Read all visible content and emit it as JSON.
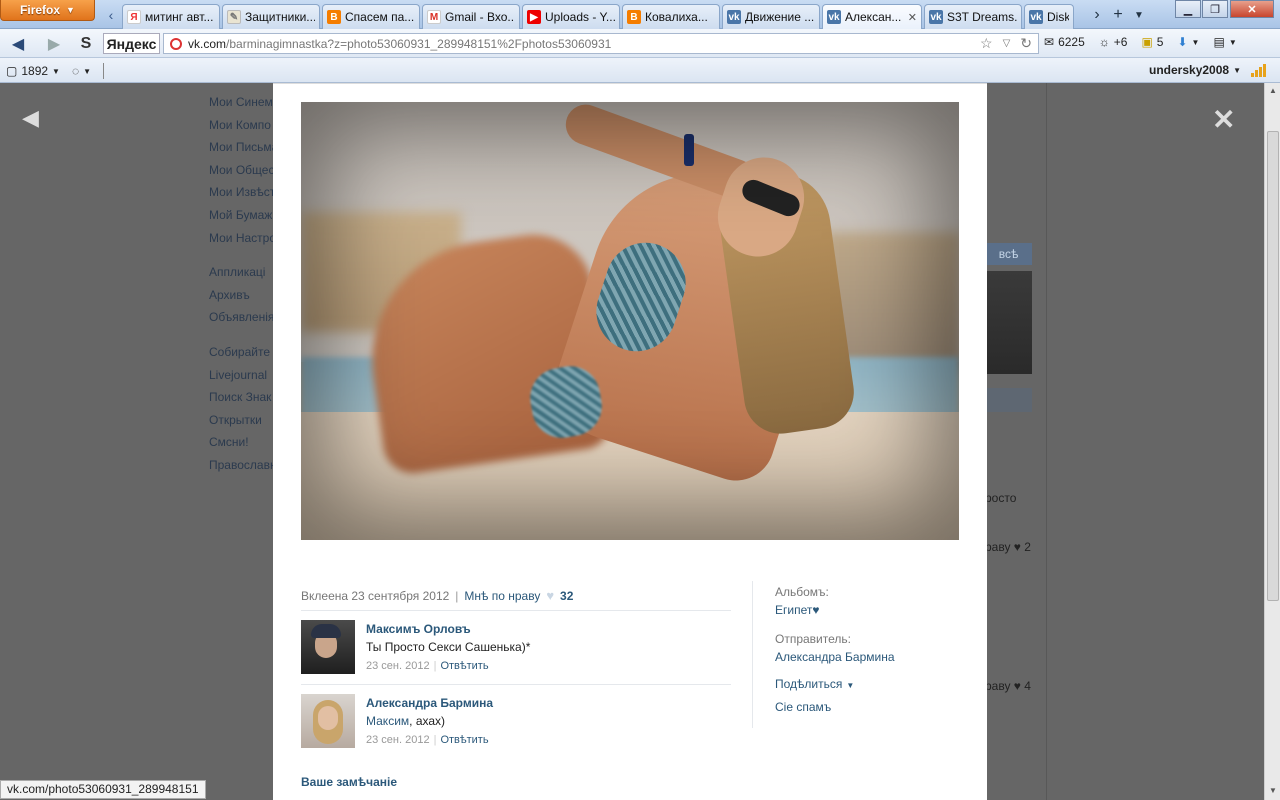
{
  "browser": {
    "app_button": "Firefox",
    "tabs": [
      {
        "title": "митинг авт...",
        "icon": "yandex-icon",
        "color": "#e33"
      },
      {
        "title": "Защитники...",
        "icon": "page-icon",
        "color": "#bca"
      },
      {
        "title": "Спасем па...",
        "icon": "blogger-icon",
        "color": "#f57d00"
      },
      {
        "title": "Gmail - Вхо...",
        "icon": "gmail-icon",
        "color": "#d93025"
      },
      {
        "title": "Uploads - Y...",
        "icon": "youtube-icon",
        "color": "#e00"
      },
      {
        "title": "Ковалиха...",
        "icon": "blogger-icon",
        "color": "#f57d00"
      },
      {
        "title": "Движение ...",
        "icon": "vk-icon",
        "color": "#4a76a8"
      },
      {
        "title": "Алексан...",
        "icon": "vk-icon",
        "color": "#4a76a8",
        "active": true
      },
      {
        "title": "S3T Dreams...",
        "icon": "vk-icon",
        "color": "#4a76a8"
      },
      {
        "title": "Diskote",
        "icon": "vk-icon",
        "color": "#4a76a8"
      }
    ],
    "search_engine_label": "Яндекс",
    "url_domain": "vk.com",
    "url_rest": "/barminagimnastka?z=photo53060931_289948151%2Fphotos53060931",
    "mail_count": "6225",
    "weather": "+6",
    "bonus_count": "5",
    "bookmarks_count": "1892",
    "username": "undersky2008",
    "status_url": "vk.com/photo53060931_289948151"
  },
  "background_menu": {
    "items_1": [
      "Мои Синем",
      "Мои Компо",
      "Мои Письма",
      "Мои Общес",
      "Мои Извѣст",
      "Мой Бумаж",
      "Мои Настро"
    ],
    "items_2": [
      "Аппликаці",
      "Архивъ",
      "Объявленія"
    ],
    "items_3": [
      "Собирайте",
      "Livejournal",
      "Поиск Знак",
      "Открытки",
      "Смсни!",
      "Православн"
    ]
  },
  "background_right": {
    "all_label": "всѣ",
    "text_1": "росто",
    "likes_1": "раву ♥ 2",
    "likes_2": "раву ♥ 4"
  },
  "photo": {
    "posted_label": "Вклеена 23 сентября 2012",
    "like_label": "Мнѣ по нраву",
    "like_count": "32",
    "comments": [
      {
        "author": "Максимъ Орловъ",
        "text": "Ты Просто Секси Сашенька)*",
        "mention": "",
        "date": "23 сен. 2012",
        "reply_label": "Отвѣтить"
      },
      {
        "author": "Александра Бармина",
        "text": ", ахах)",
        "mention": "Максим",
        "date": "23 сен. 2012",
        "reply_label": "Отвѣтить"
      }
    ],
    "album_label": "Альбомъ:",
    "album_name": "Египет♥",
    "sender_label": "Отправитель:",
    "sender_name": "Александра Бармина",
    "share_label": "Подѣлиться",
    "spam_label": "Сіе спамъ",
    "remark_label": "Ваше замѣчаніе"
  },
  "colors": {
    "link": "#2b587a",
    "accent_orange": "#e0731b"
  }
}
